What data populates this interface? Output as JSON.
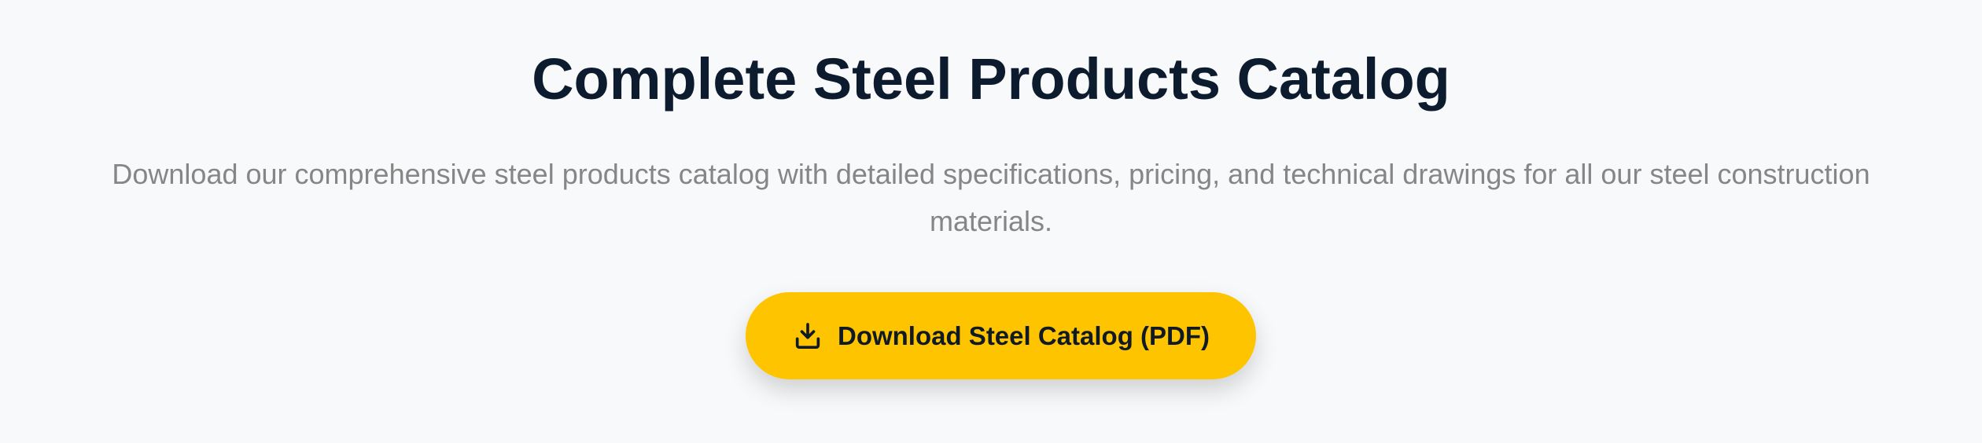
{
  "section": {
    "title": "Complete Steel Products Catalog",
    "description": "Download our comprehensive steel products catalog with detailed specifications, pricing, and technical drawings for all our steel construction materials."
  },
  "download_button": {
    "label": "Download Steel Catalog (PDF)",
    "icon": "download-icon",
    "background_color": "#ffc400",
    "text_color": "#101a24"
  },
  "colors": {
    "page_background": "#f8f9fa",
    "title": "#0d1b2e",
    "description": "#868686"
  }
}
